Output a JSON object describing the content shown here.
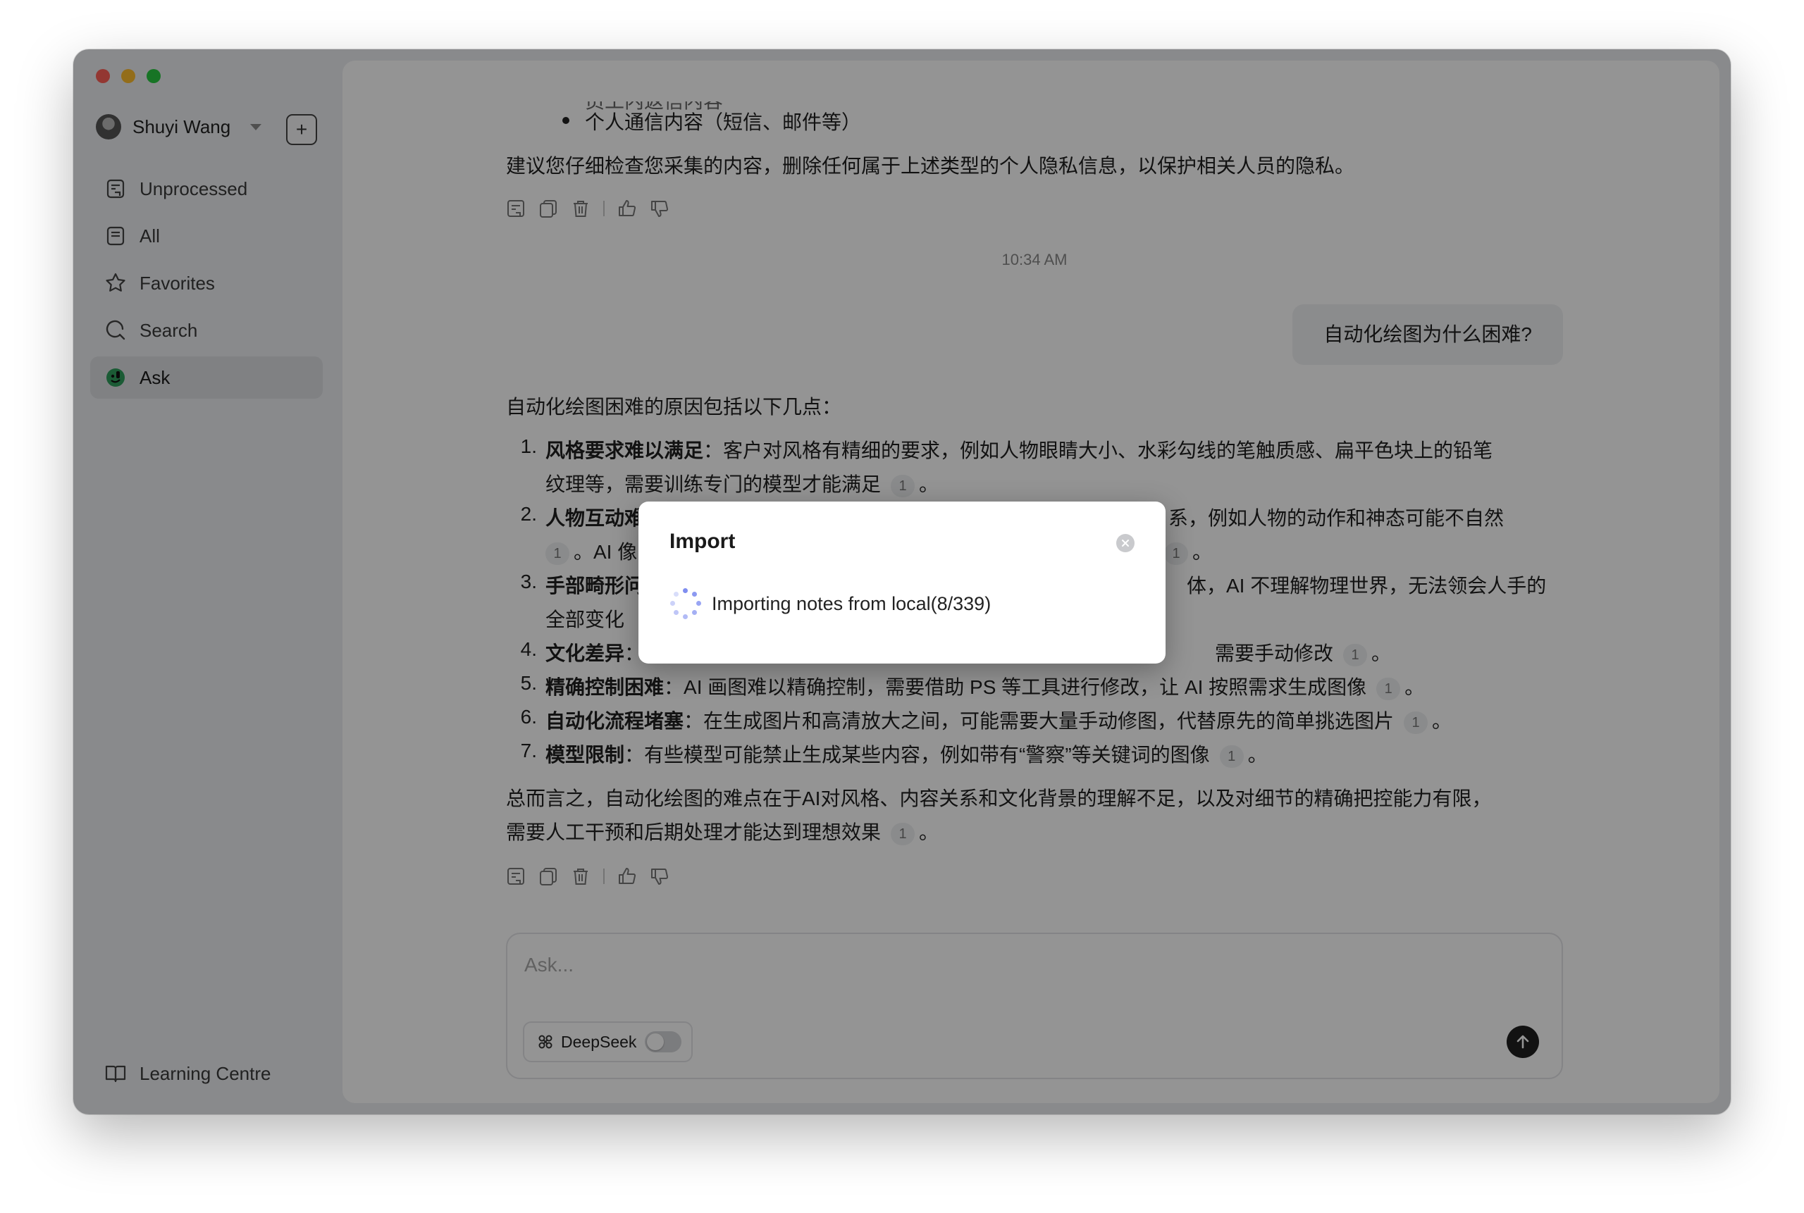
{
  "sidebar": {
    "user_name": "Shuyi Wang",
    "add_label": "+",
    "items": [
      {
        "label": "Unprocessed",
        "icon": "inbox-note-icon"
      },
      {
        "label": "All",
        "icon": "notes-icon"
      },
      {
        "label": "Favorites",
        "icon": "star-icon"
      },
      {
        "label": "Search",
        "icon": "search-icon"
      },
      {
        "label": "Ask",
        "icon": "ask-icon",
        "active": true
      }
    ],
    "footer_label": "Learning Centre"
  },
  "chat": {
    "top_partial_line": "员工内返信内容",
    "prev_bullet": "个人通信内容（短信、邮件等）",
    "prev_advice": "建议您仔细检查您采集的内容，删除任何属于上述类型的个人隐私信息，以保护相关人员的隐私。",
    "timestamp": "10:34 AM",
    "user_question": "自动化绘图为什么困难?",
    "answer_intro": "自动化绘图困难的原因包括以下几点：",
    "points": [
      {
        "num": "1.",
        "title": "风格要求难以满足",
        "text_a": "：客户对风格有精细的要求，例如人物眼睛大小、水彩勾线的笔触质感、扁平色块上的铅笔",
        "text_b": "纹理等，需要训练专门的模型才能满足",
        "cite": "1"
      },
      {
        "num": "2.",
        "title": "人物互动难",
        "text_a": "系，例如人物的动作和神态可能不自然",
        "text_b_pre": "。AI 像",
        "text_b_post": "。",
        "cite": "1"
      },
      {
        "num": "3.",
        "title": "手部畸形问",
        "text_a": "体，AI 不理解物理世界，无法领会人手的",
        "text_b": "全部变化",
        "cite": "1"
      },
      {
        "num": "4.",
        "title": "文化差异",
        "text_a": "需要手动修改",
        "cite": "1"
      },
      {
        "num": "5.",
        "title": "精确控制困难",
        "text_a": "：AI 画图难以精确控制，需要借助 PS 等工具进行修改，让 AI 按照需求生成图像",
        "cite": "1"
      },
      {
        "num": "6.",
        "title": "自动化流程堵塞",
        "text_a": "：在生成图片和高清放大之间，可能需要大量手动修图，代替原先的简单挑选图片",
        "cite": "1"
      },
      {
        "num": "7.",
        "title": "模型限制",
        "text_a": "：有些模型可能禁止生成某些内容，例如带有“警察”等关键词的图像",
        "cite": "1"
      }
    ],
    "summary_a": "总而言之，自动化绘图的难点在于AI对风格、内容关系和文化背景的理解不足，以及对细节的精确把控能力有限，",
    "summary_b": "需要人工干预和后期处理才能达到理想效果",
    "summary_cite": "1",
    "period": "。"
  },
  "composer": {
    "placeholder": "Ask...",
    "model_label": "DeepSeek",
    "model_enabled": false
  },
  "dialog": {
    "title": "Import",
    "message": "Importing notes from local(8/339)"
  },
  "colors": {
    "overlay": "#000000",
    "accent_spinner": "#7f8ef0",
    "active_nav_bg": "#dcdee2"
  }
}
